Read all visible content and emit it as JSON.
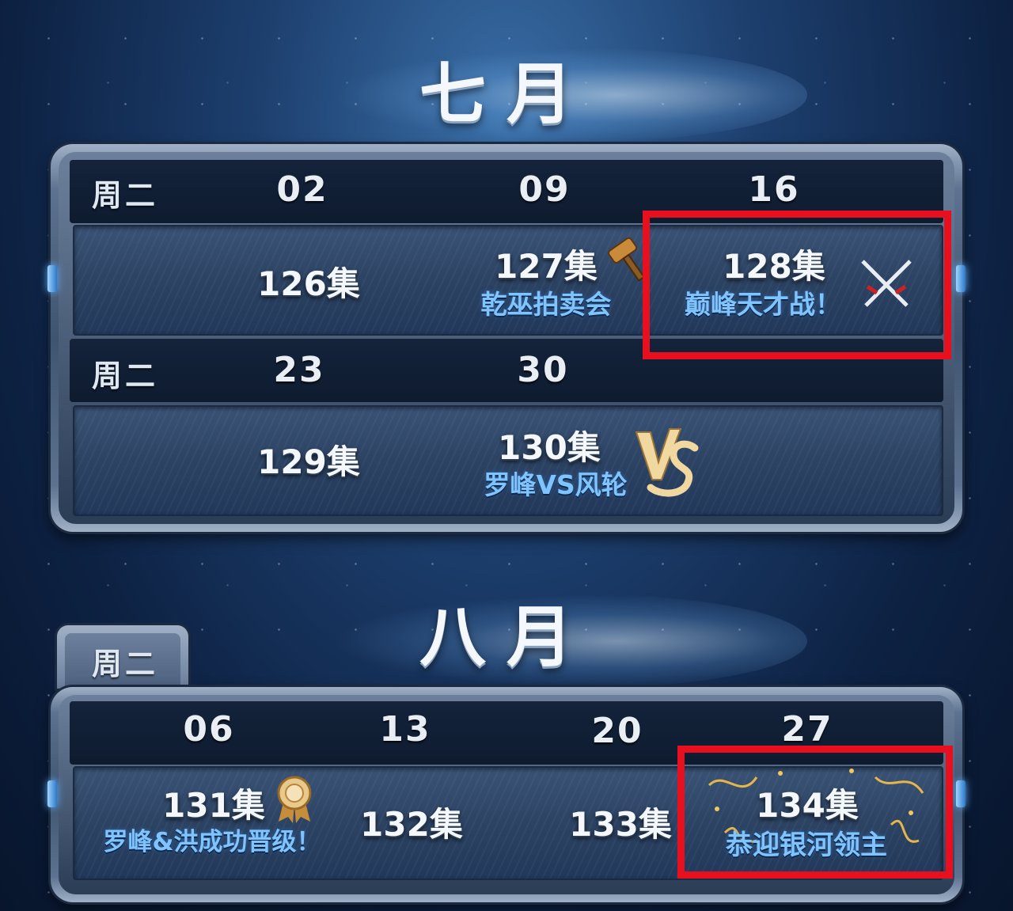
{
  "july": {
    "title": "七月",
    "row1": {
      "weekday": "周二",
      "dates": [
        "02",
        "09",
        "16"
      ],
      "episodes": [
        {
          "ep": "126集",
          "sub": ""
        },
        {
          "ep": "127集",
          "sub": "乾巫拍卖会",
          "icon": "gavel-icon"
        },
        {
          "ep": "128集",
          "sub": "巅峰天才战！",
          "icon": "crossed-swords-icon"
        }
      ]
    },
    "row2": {
      "weekday": "周二",
      "dates": [
        "23",
        "30"
      ],
      "episodes": [
        {
          "ep": "129集",
          "sub": ""
        },
        {
          "ep": "130集",
          "sub": "罗峰VS风轮",
          "icon": "vs-icon"
        }
      ]
    }
  },
  "august": {
    "title": "八月",
    "weekday": "周二",
    "dates": [
      "06",
      "13",
      "20",
      "27"
    ],
    "episodes": [
      {
        "ep": "131集",
        "sub": "罗峰&洪成功晋级！",
        "icon": "medal-icon"
      },
      {
        "ep": "132集",
        "sub": ""
      },
      {
        "ep": "133集",
        "sub": ""
      },
      {
        "ep": "134集",
        "sub": "恭迎银河领主",
        "icon": "confetti-icon"
      }
    ]
  },
  "colors": {
    "highlight": "#e8101e",
    "subtitle": "#7fc4ff",
    "title": "#f4f8fc"
  }
}
